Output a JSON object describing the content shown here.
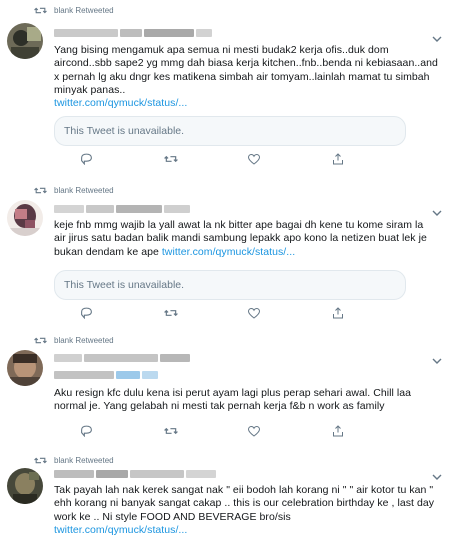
{
  "colors": {
    "meta": "#657786",
    "link": "#1b95e0",
    "text": "#14171a",
    "divider": "#e6ecf0"
  },
  "icons": {
    "retweet": "retweet-icon",
    "reply": "reply-icon",
    "like": "heart-icon",
    "share": "share-icon",
    "more": "chevron-down-icon"
  },
  "tweets": [
    {
      "social_context": "blank Retweeted",
      "body_text": "Yang bising mengamuk apa semua ni mesti budak2 kerja ofis..duk dom aircond..sbb sape2 yg mmg dah biasa kerja kitchen..fnb..benda ni kebiasaan..and x pernah lg aku dngr kes matikena simbah air tomyam..lainlah mamat tu simbah minyak panas..",
      "link": "twitter.com/qymuck/status/...",
      "quoted": "This Tweet is unavailable."
    },
    {
      "social_context": "blank Retweeted",
      "body_text": "keje fnb mmg wajib la yall awat la nk bitter ape bagai dh kene tu kome siram la air jirus satu badan balik mandi sambung lepakk apo kono la netizen buat lek je bukan dendam ke ape ",
      "link": "twitter.com/qymuck/status/...",
      "quoted": "This Tweet is unavailable."
    },
    {
      "social_context": "blank Retweeted",
      "body_text": "Aku resign kfc dulu kena isi perut ayam lagi plus perap sehari awal. Chill laa normal je. Yang gelabah ni mesti tak pernah kerja f&b n work as family",
      "link": "",
      "quoted": ""
    },
    {
      "social_context": "blank Retweeted",
      "body_text": "Tak payah lah nak kerek sangat nak \" eii bodoh lah korang ni \" \" air kotor tu kan \" ehh korang ni banyak sangat cakap .. this is our celebration birthday ke , last day work ke .. Ni style FOOD AND BEVERAGE bro/sis",
      "link": "twitter.com/qymuck/status/...",
      "quoted": ""
    }
  ]
}
